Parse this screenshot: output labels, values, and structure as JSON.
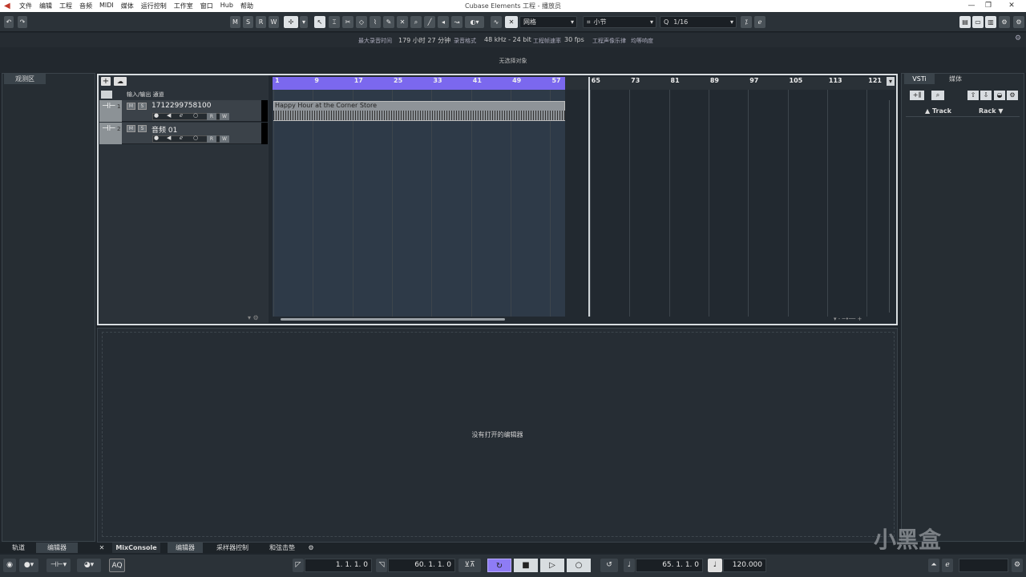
{
  "window": {
    "title": "Cubase Elements 工程 - 播放员",
    "minimize": "—",
    "maximize": "❐",
    "close": "✕"
  },
  "menu": [
    "文件",
    "编辑",
    "工程",
    "音频",
    "MIDI",
    "媒体",
    "运行控制",
    "工作室",
    "窗口",
    "Hub",
    "帮助"
  ],
  "toolbar": {
    "buttons": [
      "M",
      "S",
      "R",
      "W"
    ],
    "snap_type": "网格",
    "grid": "小节",
    "quantize": "1/16"
  },
  "info": {
    "max_rec_label": "最大录音时间",
    "max_rec_value": "179 小时 27 分钟",
    "rec_format_label": "录音格式",
    "rec_format_value": "48 kHz - 24 bit",
    "frame_label": "工程帧速率",
    "frame_value": "30 fps",
    "pan_label": "工程声像乐律",
    "pan_value": "均等响度",
    "selection": "无选择对象"
  },
  "inspector": {
    "tab": "观测区"
  },
  "tracklist": {
    "header": "输入/输出 通道",
    "tracks": [
      {
        "num": "1",
        "name": "1712299758100"
      },
      {
        "num": "2",
        "name": "音频 01"
      }
    ],
    "track_btn_m": "M",
    "track_btn_s": "S",
    "track_btn_r": "R",
    "track_btn_w": "W"
  },
  "ruler": {
    "bars": [
      "1",
      "9",
      "17",
      "25",
      "33",
      "41",
      "49",
      "57",
      "65",
      "73",
      "81",
      "89",
      "97",
      "105",
      "113",
      "121"
    ]
  },
  "clip": {
    "name": "Happy Hour at the Corner Store"
  },
  "editor": {
    "empty": "没有打开的编辑器"
  },
  "rightzone": {
    "tabs": [
      "VSTi",
      "媒体"
    ],
    "track_label": "▲ Track",
    "rack_label": "Rack ▼"
  },
  "bottomtabs": [
    "轨道",
    "编辑器",
    "MixConsole",
    "编辑器",
    "采样器控制",
    "和弦击垫"
  ],
  "transport": {
    "left_locator": "1. 1. 1.   0",
    "right_locator": "60. 1. 1.   0",
    "position": "65. 1. 1.   0",
    "tempo": "120.000",
    "aq": "AQ"
  },
  "watermark": "小黑盒"
}
